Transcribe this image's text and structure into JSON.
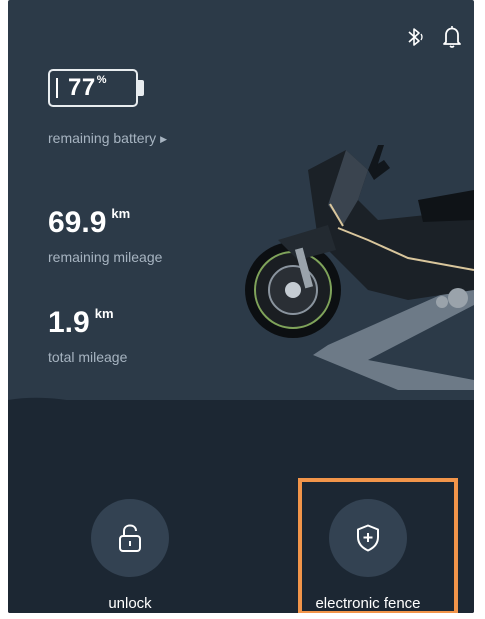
{
  "status": {
    "battery_percent": 77,
    "battery_value": "77",
    "battery_unit": "%",
    "battery_label": "remaining battery",
    "remaining_mileage_value": "69.9",
    "remaining_mileage_unit": "km",
    "remaining_mileage_label": "remaining mileage",
    "total_mileage_value": "1.9",
    "total_mileage_unit": "km",
    "total_mileage_label": "total mileage"
  },
  "header": {
    "icons": [
      "bluetooth-icon",
      "bell-icon"
    ]
  },
  "actions": {
    "unlock_label": "unlock",
    "fence_label": "electronic fence"
  },
  "colors": {
    "background": "#2c3a48",
    "panel": "#1c2733",
    "button": "#334252",
    "highlight": "#f2954a",
    "secondary_text": "#a7b4c1"
  }
}
